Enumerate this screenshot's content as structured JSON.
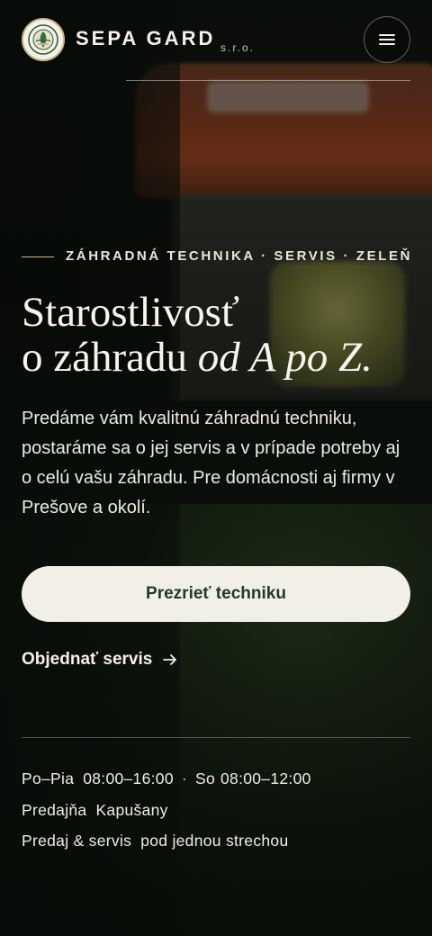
{
  "header": {
    "brand": "SEPA GARD",
    "brand_suffix": "s.r.o.",
    "logo_icon": "logo-emblem-icon",
    "menu_icon": "hamburger-menu-icon"
  },
  "hero": {
    "eyebrow": "ZÁHRADNÁ TECHNIKA · SERVIS · ZELEŇ",
    "headline_line1": "Starostlivosť",
    "headline_line2_plain": "o záhradu ",
    "headline_line2_italic": "od A po Z.",
    "lead": "Predáme vám kvalitnú záhradnú techniku, postaráme sa o jej servis a v prípade potreby aj o celú vašu záhradu. Pre domácnosti aj firmy v Prešove a okolí.",
    "primary_cta": "Prezrieť techniku",
    "secondary_cta": "Objednať servis",
    "secondary_cta_icon": "arrow-right-icon"
  },
  "info": {
    "hours_weekday_label": "Po–Pia",
    "hours_weekday": "08:00–16:00",
    "separator": "·",
    "hours_saturday_label": "So",
    "hours_saturday": "08:00–12:00",
    "store_label": "Predajňa",
    "store_location": "Kapušany",
    "services_label": "Predaj & servis",
    "services_note": "pod jednou strechou"
  },
  "colors": {
    "primary_button_bg": "#f1efe6",
    "primary_button_text": "#1f3a26",
    "accent_line": "#c9b98a",
    "text": "#f3f1ea",
    "background": "#0d120d"
  }
}
